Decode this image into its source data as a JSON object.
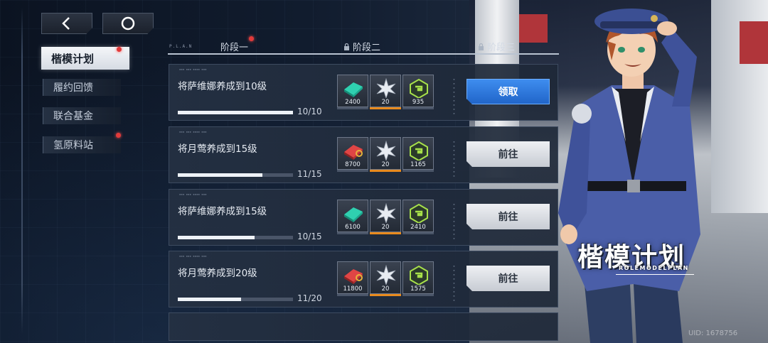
{
  "nav": {
    "back_icon": "chevron-left-icon",
    "home_icon": "circle-icon"
  },
  "sidebar": {
    "items": [
      {
        "label": "楷模计划",
        "active": true,
        "badge": true
      },
      {
        "label": "履约回馈",
        "active": false,
        "badge": false
      },
      {
        "label": "联合基金",
        "active": false,
        "badge": false
      },
      {
        "label": "氢原料站",
        "active": false,
        "badge": true
      }
    ]
  },
  "plan_tag": "P.L.A.N",
  "stages": [
    {
      "label": "阶段一",
      "locked": false,
      "badge": true
    },
    {
      "label": "阶段二",
      "locked": true
    },
    {
      "label": "阶段三",
      "locked": true
    }
  ],
  "tasks": [
    {
      "title": "将萨维娜养成到10级",
      "progress_text": "10/10",
      "progress": 1.0,
      "rewards": [
        {
          "icon": "teal-chip-icon",
          "amount": "2400"
        },
        {
          "icon": "silver-star-icon",
          "amount": "20"
        },
        {
          "icon": "green-hex-icon",
          "amount": "935"
        }
      ],
      "action": "领取",
      "action_type": "claim"
    },
    {
      "title": "将月莺养成到15级",
      "progress_text": "11/15",
      "progress": 0.733,
      "rewards": [
        {
          "icon": "red-chip-icon",
          "amount": "8700"
        },
        {
          "icon": "silver-star-icon",
          "amount": "20"
        },
        {
          "icon": "green-hex-icon",
          "amount": "1165"
        }
      ],
      "action": "前往",
      "action_type": "go"
    },
    {
      "title": "将萨维娜养成到15级",
      "progress_text": "10/15",
      "progress": 0.667,
      "rewards": [
        {
          "icon": "teal-chip-icon",
          "amount": "6100"
        },
        {
          "icon": "silver-star-icon",
          "amount": "20"
        },
        {
          "icon": "green-hex-icon",
          "amount": "2410"
        }
      ],
      "action": "前往",
      "action_type": "go"
    },
    {
      "title": "将月莺养成到20级",
      "progress_text": "11/20",
      "progress": 0.55,
      "rewards": [
        {
          "icon": "red-chip-icon",
          "amount": "11800"
        },
        {
          "icon": "silver-star-icon",
          "amount": "20"
        },
        {
          "icon": "green-hex-icon",
          "amount": "1575"
        }
      ],
      "action": "前往",
      "action_type": "go"
    }
  ],
  "banner": {
    "title": "楷模计划",
    "subtitle": "ROLEMODELPLAN"
  },
  "uid": "UID: 1678756",
  "colors": {
    "claim": "#2f7ae0",
    "accent_orange": "#e88a1d",
    "badge_red": "#e23a3a"
  }
}
